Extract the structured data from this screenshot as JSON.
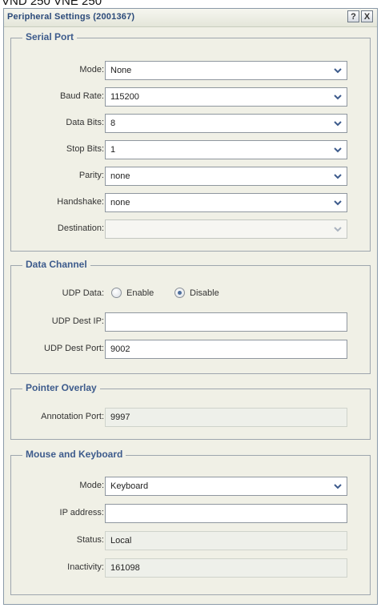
{
  "caption": "VND 250 VNE 250",
  "dialog": {
    "title": "Peripheral Settings (2001367)",
    "help_label": "?",
    "close_label": "X"
  },
  "serial": {
    "legend": "Serial Port",
    "mode": {
      "label": "Mode:",
      "value": "None"
    },
    "baud": {
      "label": "Baud Rate:",
      "value": "115200"
    },
    "data_bits": {
      "label": "Data Bits:",
      "value": "8"
    },
    "stop_bits": {
      "label": "Stop Bits:",
      "value": "1"
    },
    "parity": {
      "label": "Parity:",
      "value": "none"
    },
    "handshake": {
      "label": "Handshake:",
      "value": "none"
    },
    "destination": {
      "label": "Destination:",
      "value": ""
    }
  },
  "data_channel": {
    "legend": "Data Channel",
    "udp_data_label": "UDP Data:",
    "enable_label": "Enable",
    "disable_label": "Disable",
    "selected": "Disable",
    "dest_ip": {
      "label": "UDP Dest IP:",
      "value": ""
    },
    "dest_port": {
      "label": "UDP Dest Port:",
      "value": "9002"
    }
  },
  "pointer_overlay": {
    "legend": "Pointer Overlay",
    "annotation_port": {
      "label": "Annotation Port:",
      "value": "9997"
    }
  },
  "mouse_keyboard": {
    "legend": "Mouse and Keyboard",
    "mode": {
      "label": "Mode:",
      "value": "Keyboard"
    },
    "ip_address": {
      "label": "IP address:",
      "value": ""
    },
    "status": {
      "label": "Status:",
      "value": "Local"
    },
    "inactivity": {
      "label": "Inactivity:",
      "value": "161098"
    }
  },
  "colors": {
    "legend_text": "#3d5b8c",
    "dialog_bg": "#f0f0e6",
    "title_text": "#2b4a7a"
  },
  "icons": {
    "select_arrow": "chevron-down-icon",
    "help": "help-icon",
    "close": "close-icon"
  }
}
